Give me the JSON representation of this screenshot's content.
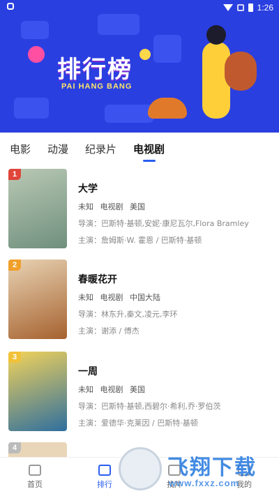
{
  "status": {
    "time": "1:26"
  },
  "banner": {
    "title": "排行榜",
    "subtitle": "PAI HANG BANG"
  },
  "tabs": [
    {
      "label": "电影"
    },
    {
      "label": "动漫"
    },
    {
      "label": "纪录片"
    },
    {
      "label": "电视剧",
      "active": true
    }
  ],
  "items": [
    {
      "rank": "1",
      "title": "大学",
      "meta": [
        "未知",
        "电视剧",
        "美国"
      ],
      "director": "导演：巴斯特·基顿,安妮·康尼瓦尔,Flora Bramley",
      "cast": "主演：詹姆斯·W. 霍恩 / 巴斯特·基顿",
      "poster_color": "#7a9c8a"
    },
    {
      "rank": "2",
      "title": "春暖花开",
      "meta": [
        "未知",
        "电视剧",
        "中国大陆"
      ],
      "director": "导演：林东升,秦文,凌元,李环",
      "cast": "主演：谢添 / 傅杰",
      "poster_color": "#c9a27a"
    },
    {
      "rank": "3",
      "title": "一周",
      "meta": [
        "未知",
        "电视剧",
        "美国"
      ],
      "director": "导演：巴斯特·基顿,西碧尔·希利,乔·罗伯茨",
      "cast": "主演：爱德华·克莱因 / 巴斯特·基顿",
      "poster_color": "#3e7fa8"
    }
  ],
  "nav": [
    {
      "label": "首页"
    },
    {
      "label": "排行",
      "active": true
    },
    {
      "label": "找片"
    },
    {
      "label": "我的"
    }
  ],
  "watermark": {
    "brand": "飞翔下载",
    "url": "www.fxxz.com"
  }
}
